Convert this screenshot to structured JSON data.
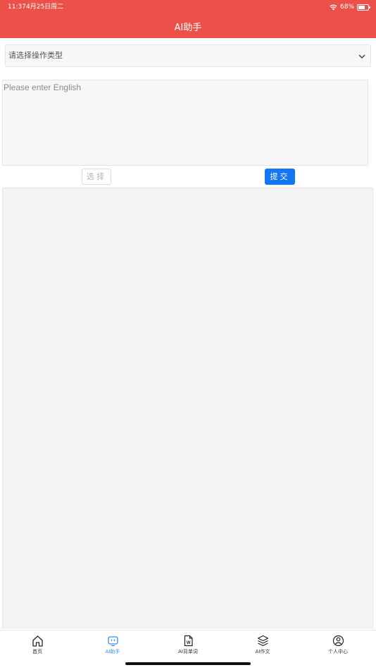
{
  "status_bar": {
    "time": "11:37",
    "date": "4月25日周二",
    "battery": "68%",
    "battery_level": 0.68
  },
  "header": {
    "title": "AI助手"
  },
  "type_select": {
    "value": "请选择操作类型"
  },
  "english_input": {
    "placeholder": "Please enter English",
    "value": ""
  },
  "buttons": {
    "choose_label": "选择",
    "submit_label": "提交"
  },
  "tabbar": {
    "items": [
      {
        "label": "首页",
        "icon": "home-icon"
      },
      {
        "label": "AI助手",
        "icon": "robot-icon",
        "active": true
      },
      {
        "label": "AI背单词",
        "icon": "word-document-icon"
      },
      {
        "label": "AI作文",
        "icon": "layers-icon"
      },
      {
        "label": "个人中心",
        "icon": "user-icon"
      }
    ]
  },
  "colors": {
    "header": "#eb5148",
    "primary": "#1377f3",
    "tab_active": "#3a8cf0"
  }
}
